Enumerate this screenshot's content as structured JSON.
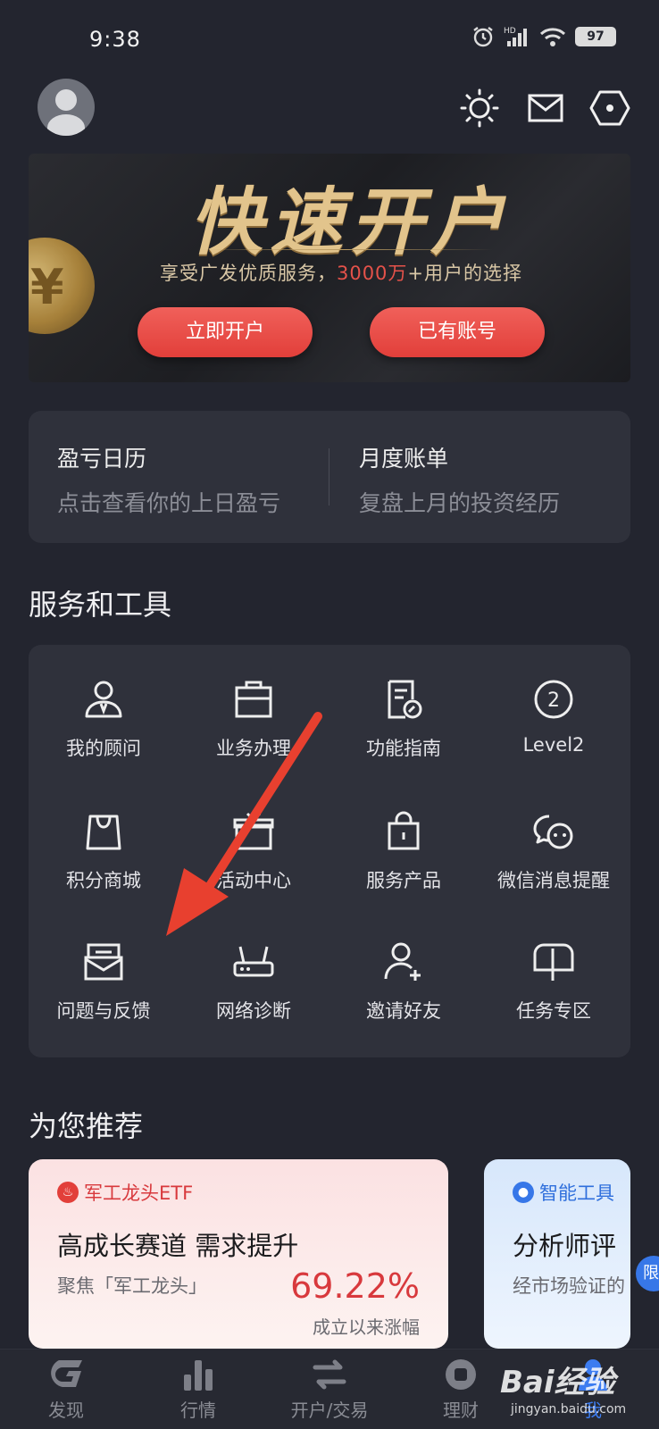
{
  "status_bar": {
    "time": "9:38",
    "battery": "97"
  },
  "banner": {
    "title": "快速开户",
    "subtitle_pre": "享受广发优质服务，",
    "subtitle_highlight": "3000万",
    "subtitle_post": "+用户的选择",
    "open_button": "立即开户",
    "login_button": "已有账号"
  },
  "pnl": {
    "calendar_title": "盈亏日历",
    "calendar_sub": "点击查看你的上日盈亏",
    "bill_title": "月度账单",
    "bill_sub": "复盘上月的投资经历"
  },
  "services": {
    "title": "服务和工具",
    "items": [
      {
        "label": "我的顾问",
        "icon": "advisor-icon"
      },
      {
        "label": "业务办理",
        "icon": "briefcase-icon"
      },
      {
        "label": "功能指南",
        "icon": "guide-icon"
      },
      {
        "label": "Level2",
        "icon": "level2-icon"
      },
      {
        "label": "积分商城",
        "icon": "shopping-bag-icon"
      },
      {
        "label": "活动中心",
        "icon": "gift-icon"
      },
      {
        "label": "服务产品",
        "icon": "lock-bag-icon"
      },
      {
        "label": "微信消息提醒",
        "icon": "wechat-icon"
      },
      {
        "label": "问题与反馈",
        "icon": "mail-feedback-icon"
      },
      {
        "label": "网络诊断",
        "icon": "router-icon"
      },
      {
        "label": "邀请好友",
        "icon": "add-user-icon"
      },
      {
        "label": "任务专区",
        "icon": "mailbox-icon"
      }
    ]
  },
  "recommend": {
    "title": "为您推荐",
    "card1": {
      "tag": "军工龙头ETF",
      "headline": "高成长赛道 需求提升",
      "sub": "聚焦「军工龙头」",
      "percent": "69.22%",
      "percent_label": "成立以来涨幅"
    },
    "card2": {
      "tag": "智能工具",
      "headline": "分析师评",
      "sub": "经市场验证的"
    },
    "limit_badge": "限"
  },
  "tabbar": {
    "items": [
      {
        "label": "发现"
      },
      {
        "label": "行情"
      },
      {
        "label": "开户/交易"
      },
      {
        "label": "理财"
      },
      {
        "label": "我"
      }
    ]
  },
  "watermark": {
    "text": "Bai经验",
    "sub": "jingyan.baidu.com"
  },
  "colors": {
    "background": "#23252f",
    "card": "#2f313b",
    "accent_red": "#e23f3a",
    "accent_blue": "#3c7cf0",
    "gold": "#e2c48c"
  }
}
